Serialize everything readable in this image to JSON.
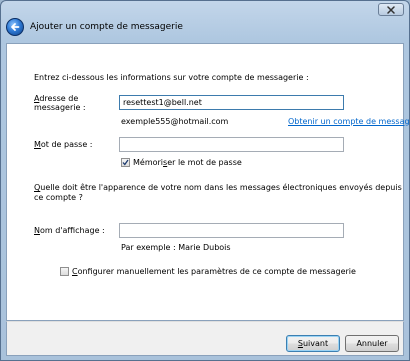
{
  "window": {
    "title": "Ajouter un compte de messagerie",
    "back_icon": "back-arrow-icon",
    "close_icon": "close-icon"
  },
  "form": {
    "intro": "Entrez ci-dessous les informations sur votre compte de messagerie :",
    "email_label_line1": "Adresse de",
    "email_label_line2": "messagerie :",
    "email_value": "resettest1@bell.net",
    "email_example": "exemple555@hotmail.com",
    "get_account_link": "Obtenir un compte de messagerie gratuit",
    "password_label": "Mot de passe :",
    "password_value": "",
    "remember_password_label": "Mémoriser le mot de passe",
    "remember_password_checked": true,
    "display_name_question_line1": "Quelle doit être l'apparence de votre nom dans les messages électroniques envoyés depuis",
    "display_name_question_line2": "ce compte ?",
    "display_name_label": "Nom d'affichage :",
    "display_name_value": "",
    "display_name_example": "Par exemple : Marie Dubois",
    "manual_config_label": "Configurer manuellement les paramètres de ce compte de messagerie",
    "manual_config_checked": false
  },
  "buttons": {
    "next_label": "Suivant",
    "cancel_label": "Annuler"
  }
}
